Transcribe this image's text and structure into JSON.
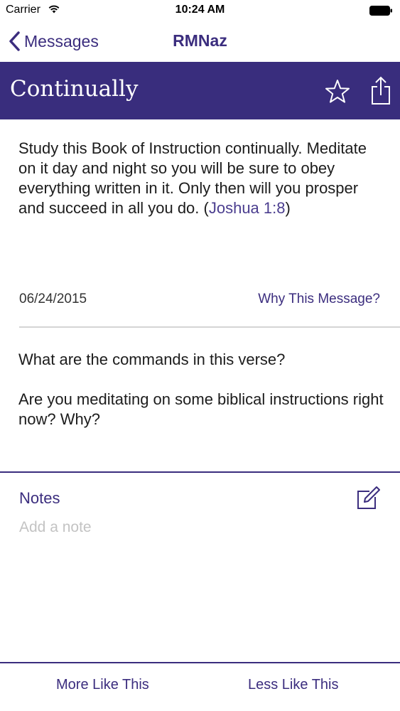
{
  "status_bar": {
    "carrier": "Carrier",
    "time": "10:24 AM",
    "wifi_icon": "wifi-icon",
    "battery_icon": "battery-icon"
  },
  "nav": {
    "back_label": "Messages",
    "back_icon": "chevron-left-icon",
    "title": "RMNaz"
  },
  "banner": {
    "title": "Continually",
    "background_color": "#392d7d",
    "favorite_icon": "star-icon",
    "share_icon": "share-icon"
  },
  "message": {
    "verse_text": "Study this Book of Instruction continually. Meditate on it day and night so you will be sure to obey everything written in it. Only then will you prosper and succeed in all you do. (",
    "verse_reference": "Joshua 1:8",
    "verse_close": ")",
    "date": "06/24/2015",
    "why_link": "Why This Message?",
    "questions": [
      "What are the commands in this verse?",
      "Are you meditating on some biblical instructions right now? Why?"
    ]
  },
  "notes": {
    "label": "Notes",
    "placeholder": "Add a note",
    "value": "",
    "edit_icon": "edit-icon"
  },
  "footer": {
    "more_label": "More Like This",
    "less_label": "Less Like This"
  },
  "colors": {
    "accent": "#3b2d7e",
    "placeholder": "#c3c3c3"
  }
}
